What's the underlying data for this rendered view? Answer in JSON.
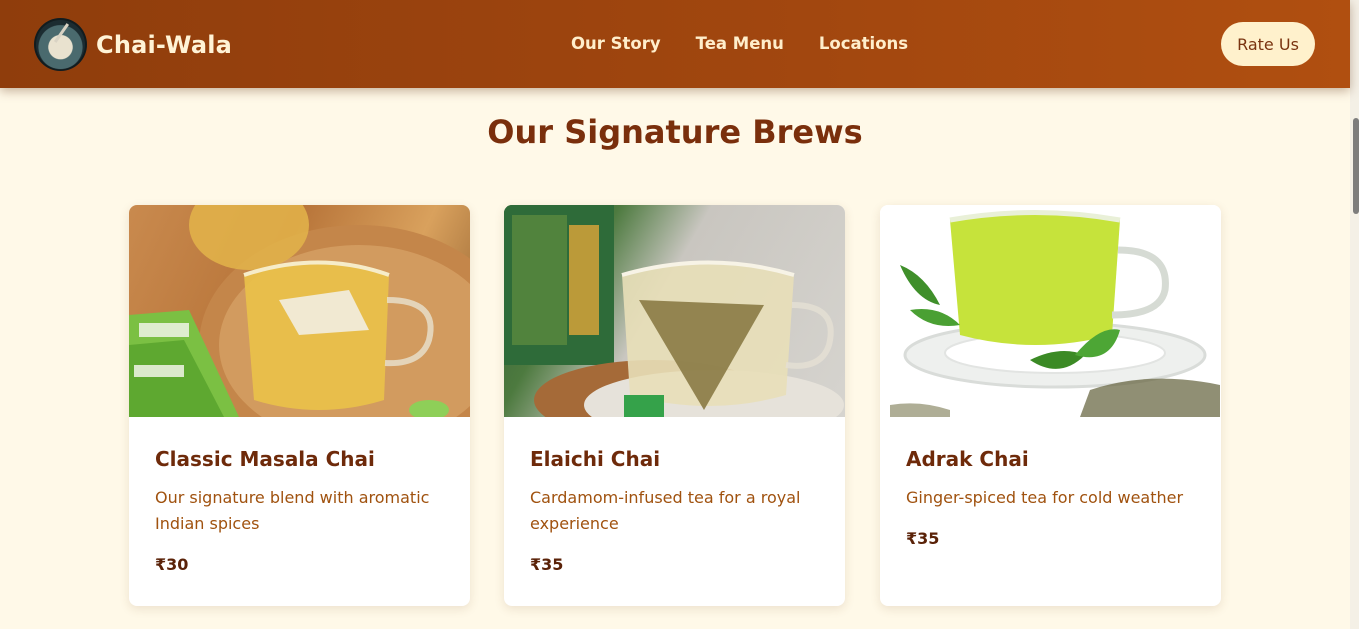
{
  "header": {
    "brand": "Chai-Wala",
    "nav": [
      "Our Story",
      "Tea Menu",
      "Locations"
    ],
    "cta": "Rate Us"
  },
  "main": {
    "section_title": "Our Signature Brews",
    "products": [
      {
        "name": "Classic Masala Chai",
        "description": "Our signature blend with aromatic Indian spices",
        "price": "₹30"
      },
      {
        "name": "Elaichi Chai",
        "description": "Cardamom-infused tea for a royal experience",
        "price": "₹35"
      },
      {
        "name": "Adrak Chai",
        "description": "Ginger-spiced tea for cold weather",
        "price": "₹35"
      }
    ]
  },
  "colors": {
    "header_bg": "#a2470f",
    "page_bg": "#fff9e8",
    "title": "#7a2f0c",
    "button_bg": "#fff1cc"
  }
}
